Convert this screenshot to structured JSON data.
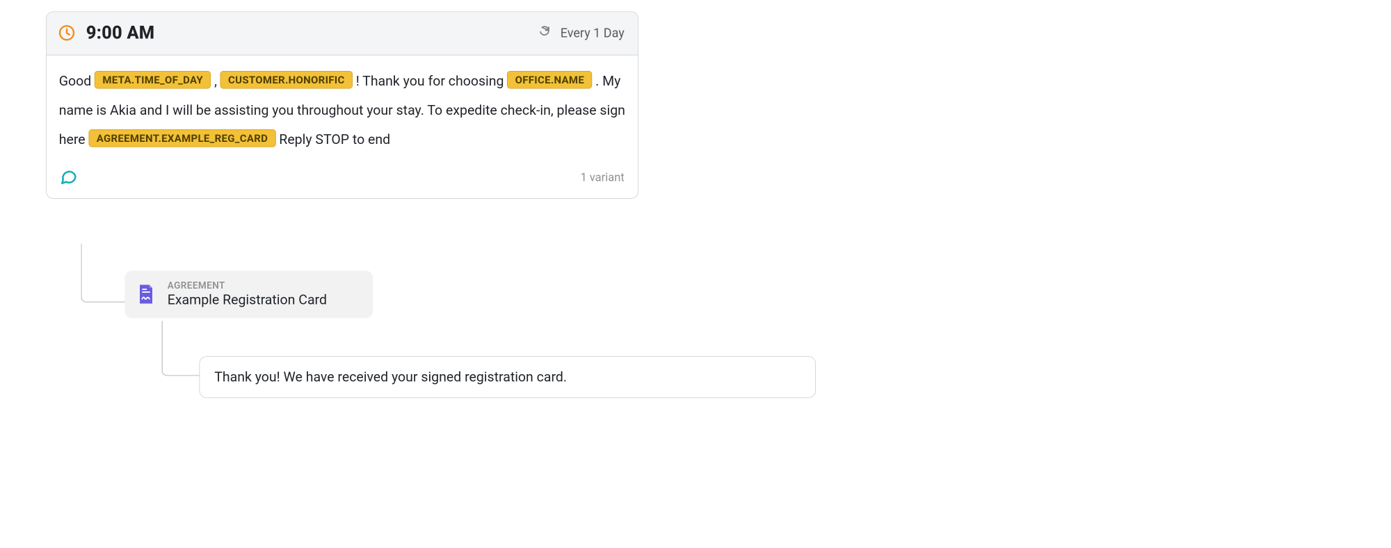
{
  "card": {
    "time": "9:00 AM",
    "recurrence": "Every 1 Day",
    "variants_label": "1 variant",
    "body": {
      "t1": "Good ",
      "tag1": "META.TIME_OF_DAY",
      "t2": ", ",
      "tag2": "CUSTOMER.HONORIFIC",
      "t3": "! Thank you for choosing ",
      "tag3": "OFFICE.NAME",
      "t4": ". My name is Akia and I will be assisting you throughout your stay. To expedite check-in, please sign here ",
      "tag4": "AGREEMENT.EXAMPLE_REG_CARD",
      "t5": " Reply STOP to end"
    }
  },
  "agreement": {
    "label": "AGREEMENT",
    "title": "Example Registration Card"
  },
  "reply": {
    "text": "Thank you! We have received your signed registration card."
  }
}
